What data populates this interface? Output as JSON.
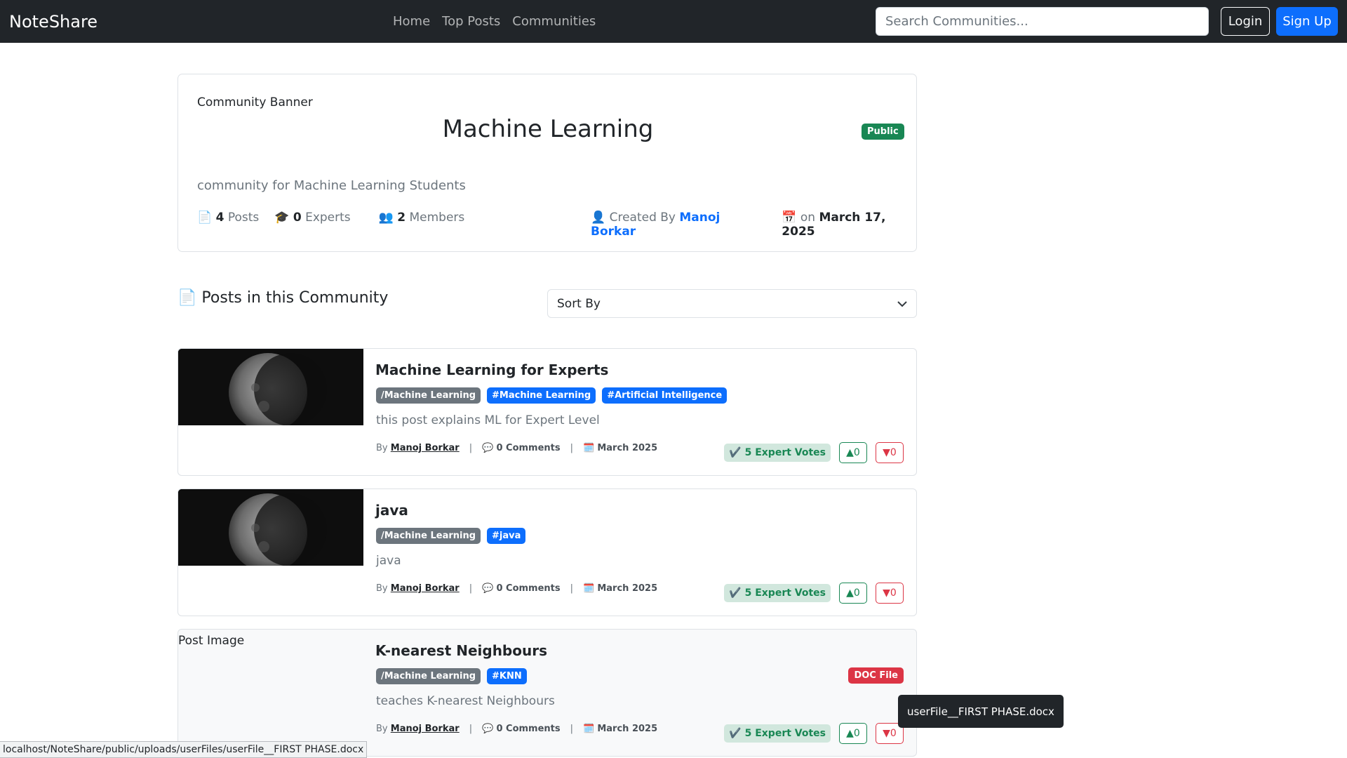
{
  "navbar": {
    "brand": "NoteShare",
    "links": [
      "Home",
      "Top Posts",
      "Communities"
    ],
    "search_placeholder": "Search Communities...",
    "login_label": "Login",
    "signup_label": "Sign Up"
  },
  "community": {
    "banner_alt": "Community Banner",
    "name": "Machine Learning",
    "visibility": "Public",
    "description": "community for Machine Learning Students",
    "posts_count": "4",
    "posts_label": "Posts",
    "experts_count": "0",
    "experts_label": "Experts",
    "members_count": "2",
    "members_label": "Members",
    "created_by_label": "Created By",
    "creator": "Manoj Borkar",
    "created_on_label": "on",
    "created_date": "March 17, 2025"
  },
  "posts_section": {
    "heading": "Posts in this Community",
    "sort_label": "Sort By"
  },
  "posts": [
    {
      "title": "Machine Learning for Experts",
      "community_tag": "/Machine Learning",
      "tags": [
        "#Machine Learning",
        "#Artificial Intelligence"
      ],
      "description": "this post explains ML for Expert Level",
      "by_label": "By",
      "author": "Manoj Borkar",
      "comments": "0 Comments",
      "date": "March 2025",
      "expert_votes": "5 Expert Votes",
      "upvotes": "0",
      "downvotes": "0"
    },
    {
      "title": "java",
      "community_tag": "/Machine Learning",
      "tags": [
        "#java"
      ],
      "description": "java",
      "by_label": "By",
      "author": "Manoj Borkar",
      "comments": "0 Comments",
      "date": "March 2025",
      "expert_votes": "5 Expert Votes",
      "upvotes": "0",
      "downvotes": "0"
    },
    {
      "title": "K-nearest Neighbours",
      "image_alt": "Post Image",
      "community_tag": "/Machine Learning",
      "tags": [
        "#KNN"
      ],
      "description": "teaches K-nearest Neighbours",
      "file_badge": "DOC File",
      "by_label": "By",
      "author": "Manoj Borkar",
      "comments": "0 Comments",
      "date": "March 2025",
      "expert_votes": "5 Expert Votes",
      "upvotes": "0",
      "downvotes": "0"
    }
  ],
  "tooltip": "userFile__FIRST PHASE.docx",
  "status_url": "localhost/NoteShare/public/uploads/userFiles/userFile__FIRST PHASE.docx",
  "colors": {
    "navbar_bg": "#212529",
    "primary": "#0d6efd",
    "success": "#198754",
    "danger": "#dc3545",
    "secondary": "#6c757d"
  }
}
